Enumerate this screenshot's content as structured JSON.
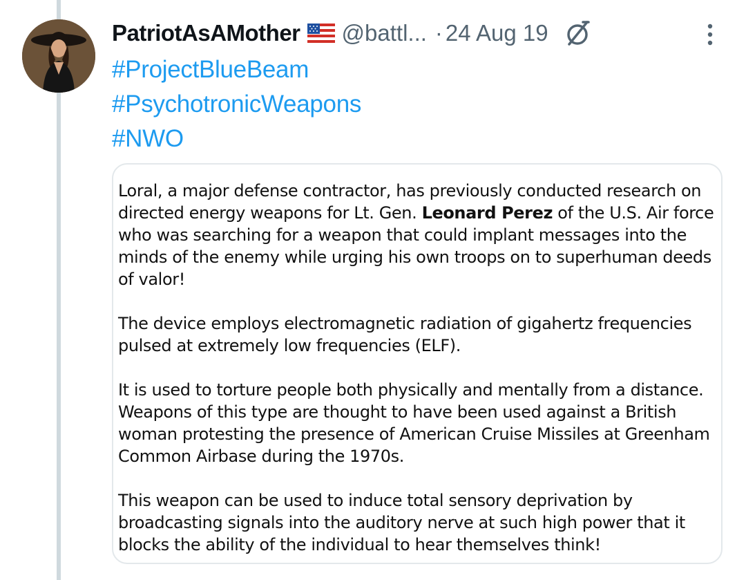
{
  "tweet": {
    "author_name": "PatriotAsAMother",
    "flag_emoji": "🇺🇸",
    "handle": "@battl...",
    "separator": "·",
    "date": "24 Aug 19",
    "hashtags": [
      "#ProjectBlueBeam",
      "#PsychotronicWeapons",
      "#NWO"
    ],
    "icons": {
      "avatar": "profile-avatar",
      "flag": "us-flag-icon",
      "edited": "edited-icon",
      "more": "more-vertical-icon"
    },
    "colors": {
      "link": "#1d9bf0",
      "secondary_text": "#536471",
      "primary_text": "#0f1419",
      "thread_line": "#cfd9de"
    }
  },
  "image_text": {
    "p1_before": "Loral, a major defense contractor, has previously conducted research on directed energy weapons for Lt. Gen. ",
    "p1_bold": "Leonard Perez",
    "p1_after": " of the U.S. Air force who was searching for a weapon that could implant messages into the minds of the enemy while urging his own troops on to superhuman deeds of valor!",
    "p2": "The device employs electromagnetic radiation of gigahertz frequencies pulsed at extremely low frequencies (ELF).",
    "p3": "It is used to torture people both physically and mentally from a distance. Weapons of this type are thought to have been used against a British woman protesting the presence of American Cruise Missiles at Greenham Common Airbase during the 1970s.",
    "p4": "This weapon can be used to induce total sensory deprivation by broadcasting signals into the auditory nerve at such high power that it blocks the ability of the individual to hear themselves think!"
  }
}
